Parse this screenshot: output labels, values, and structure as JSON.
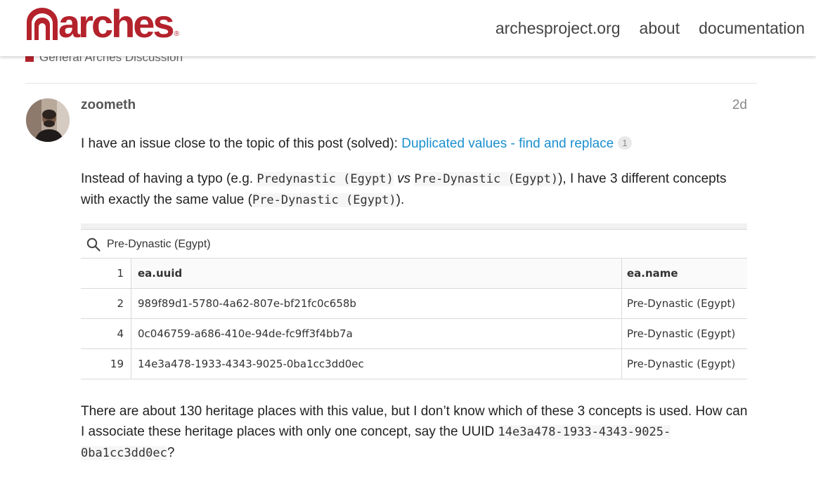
{
  "header": {
    "logo_text": "arches",
    "logo_mark": "®",
    "nav": [
      "archesproject.org",
      "about",
      "documentation"
    ],
    "brand_color": "#b4222c"
  },
  "breadcrumb": {
    "category": "General Arches Discussion"
  },
  "post": {
    "username": "zoometh",
    "date": "2d",
    "p1_text": "I have an issue close to the topic of this post (solved): ",
    "p1_link": "Duplicated values - find and replace",
    "p1_badge": "1",
    "p2_a": "Instead of having a typo (e.g. ",
    "p2_code1": "Predynastic (Egypt)",
    "p2_vs": "vs",
    "p2_code2": "Pre-Dynastic (Egypt)",
    "p2_b": "), I have 3 different concepts with exactly the same value (",
    "p2_code3": "Pre-Dynastic (Egypt)",
    "p2_c": ").",
    "p3_a": "There are about 130 heritage places with this value, but I don’t know which of these 3 concepts is used. How can I associate these heritage places with only one concept, say the UUID ",
    "p3_code": "14e3a478-1933-4343-9025-0ba1cc3dd0ec",
    "p3_b": "?"
  },
  "table": {
    "search_value": "Pre-Dynastic (Egypt)",
    "header_row": {
      "num": "1",
      "col1": "ea.uuid",
      "col2": "ea.name"
    },
    "rows": [
      {
        "num": "2",
        "uuid": "989f89d1-5780-4a62-807e-bf21fc0c658b",
        "name": "Pre-Dynastic (Egypt)"
      },
      {
        "num": "4",
        "uuid": "0c046759-a686-410e-94de-fc9ff3f4bb7a",
        "name": "Pre-Dynastic (Egypt)"
      },
      {
        "num": "19",
        "uuid": "14e3a478-1933-4343-9025-0ba1cc3dd0ec",
        "name": "Pre-Dynastic (Egypt)"
      }
    ]
  }
}
